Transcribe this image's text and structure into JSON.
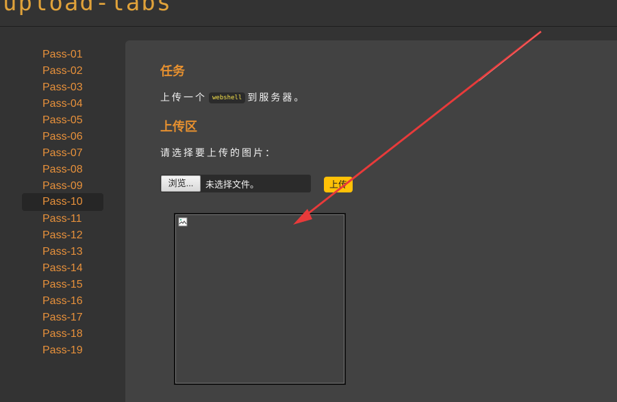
{
  "header": {
    "logo_text": "upload-labs"
  },
  "sidebar": {
    "items": [
      {
        "label": "Pass-01"
      },
      {
        "label": "Pass-02"
      },
      {
        "label": "Pass-03"
      },
      {
        "label": "Pass-04"
      },
      {
        "label": "Pass-05"
      },
      {
        "label": "Pass-06"
      },
      {
        "label": "Pass-07"
      },
      {
        "label": "Pass-08"
      },
      {
        "label": "Pass-09"
      },
      {
        "label": "Pass-10"
      },
      {
        "label": "Pass-11"
      },
      {
        "label": "Pass-12"
      },
      {
        "label": "Pass-13"
      },
      {
        "label": "Pass-14"
      },
      {
        "label": "Pass-15"
      },
      {
        "label": "Pass-16"
      },
      {
        "label": "Pass-17"
      },
      {
        "label": "Pass-18"
      },
      {
        "label": "Pass-19"
      }
    ],
    "active_label": "Pass-10"
  },
  "main": {
    "task_title": "任务",
    "task_text_before": "上传一个",
    "task_code": "webshell",
    "task_text_after": "到服务器。",
    "upload_title": "上传区",
    "upload_prompt": "请选择要上传的图片：",
    "browse_label": "浏览...",
    "file_status": "未选择文件。",
    "upload_button_label": "上传"
  },
  "colors": {
    "accent": "#e8912f",
    "upload_button": "#ffc107",
    "arrow": "#e83a3a"
  }
}
